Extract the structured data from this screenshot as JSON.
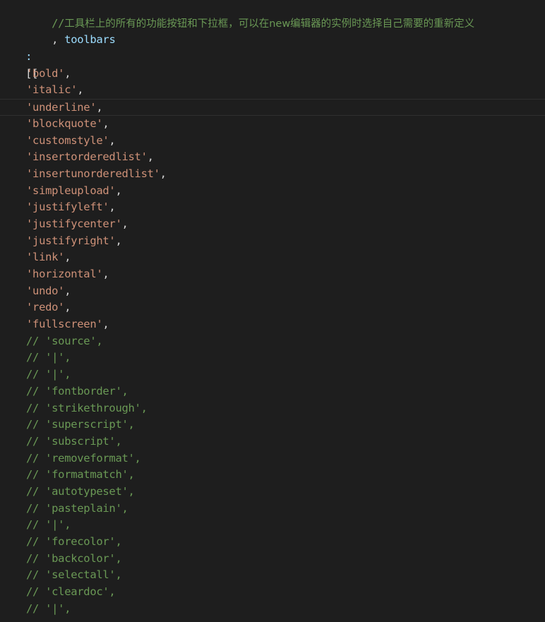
{
  "editor": {
    "header_comment_prefix": "//",
    "header_comment_text": "工具栏上的所有的功能按钮和下拉框，可以在new编辑器的实例时选择自己需要的重新定义",
    "toolbars_line_prefix": ", ",
    "toolbars_key": "toolbars",
    "colon": ":",
    "open_brackets": "[[",
    "active_items": [
      "'bold'",
      "'italic'",
      "'underline'",
      "'blockquote'",
      "'customstyle'",
      "'insertorderedlist'",
      "'insertunorderedlist'",
      "'simpleupload'",
      "'justifyleft'",
      "'justifycenter'",
      "'justifyright'",
      "'link'",
      "'horizontal'",
      "'undo'",
      "'redo'",
      "'fullscreen'"
    ],
    "item_separator": ",",
    "commented_items": [
      "// 'source',",
      "// '|',",
      "// '|',",
      "// 'fontborder',",
      "// 'strikethrough',",
      "// 'superscript',",
      "// 'subscript',",
      "// 'removeformat',",
      "// 'formatmatch',",
      "// 'autotypeset',",
      "// 'pasteplain',",
      "// '|',",
      "// 'forecolor',",
      "// 'backcolor',",
      "// 'selectall',",
      "// 'cleardoc',",
      "// '|',"
    ],
    "colors": {
      "background": "#1e1e1e",
      "comment": "#6a9955",
      "string": "#ce9178",
      "punctuation": "#d4d4d4",
      "property": "#9cdcfe"
    }
  }
}
